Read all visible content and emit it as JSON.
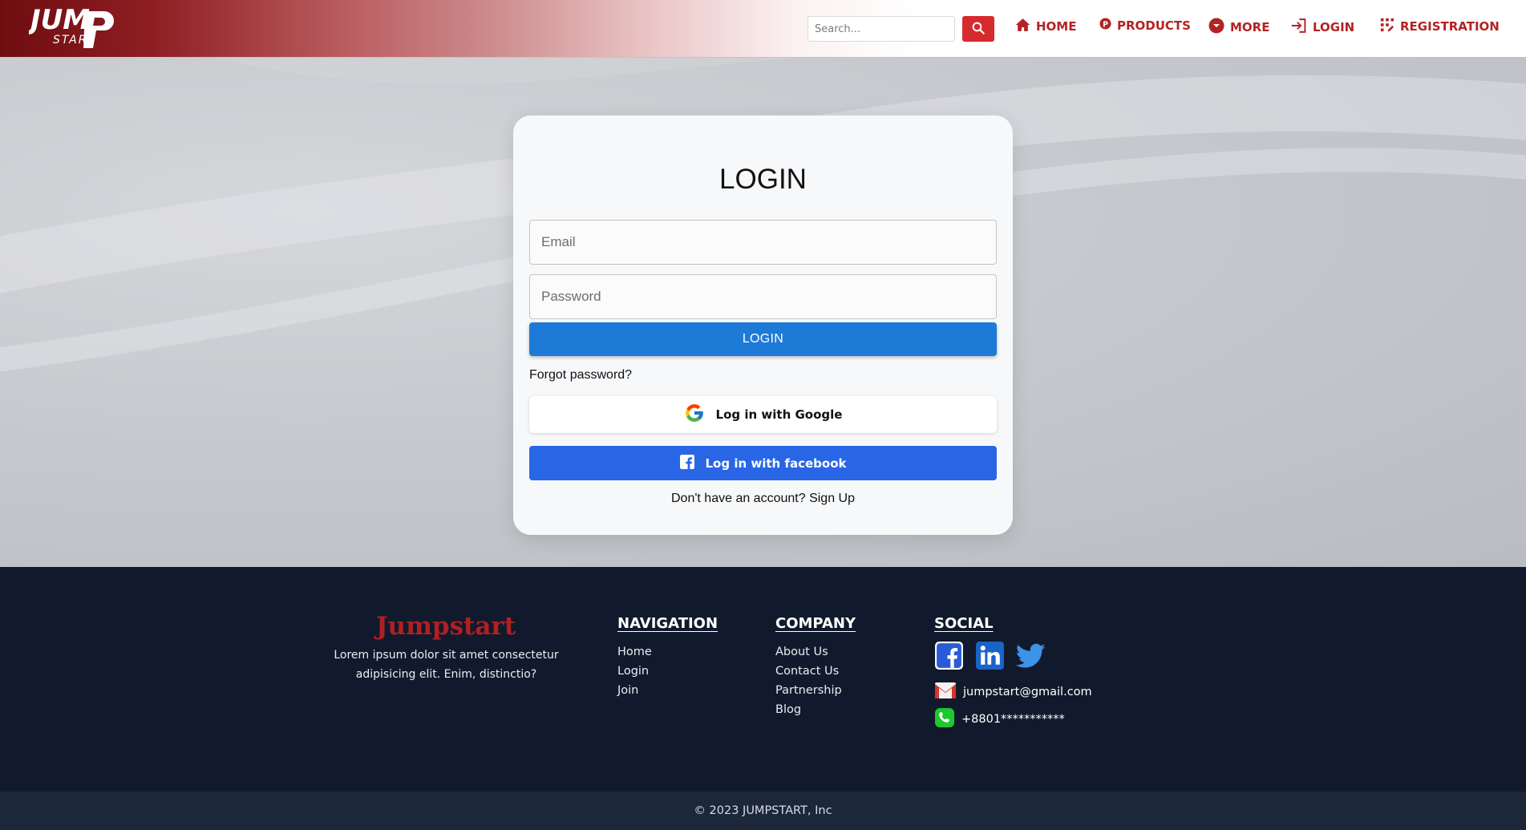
{
  "header": {
    "logo_text": "JUMP START",
    "search": {
      "placeholder": "Search..."
    },
    "nav": [
      {
        "label": "HOME",
        "icon": "home-icon"
      },
      {
        "label": "PRODUCTS",
        "icon": "p-badge-icon"
      },
      {
        "label": "MORE",
        "icon": "chevron-down-circle-icon"
      },
      {
        "label": "LOGIN",
        "icon": "login-icon"
      },
      {
        "label": "REGISTRATION",
        "icon": "registration-icon"
      }
    ]
  },
  "login_card": {
    "title": "LOGIN",
    "email_placeholder": "Email",
    "password_placeholder": "Password",
    "login_button": "LOGIN",
    "forgot_password": "Forgot password?",
    "google_button": "Log in with Google",
    "facebook_button": "Log in with facebook",
    "signup_prompt": "Don't have an account?",
    "signup_link": "Sign Up"
  },
  "footer": {
    "brand": "Jumpstart",
    "description": "Lorem ipsum dolor sit amet consectetur adipisicing elit. Enim, distinctio?",
    "navigation": {
      "title": "NAVIGATION",
      "items": [
        "Home",
        "Login",
        "Join"
      ]
    },
    "company": {
      "title": "COMPANY",
      "items": [
        "About Us",
        "Contact Us",
        "Partnership",
        "Blog"
      ]
    },
    "social": {
      "title": "SOCIAL",
      "icons": [
        "facebook-icon",
        "linkedin-icon",
        "twitter-icon"
      ],
      "email": "jumpstart@gmail.com",
      "phone": "+8801***********"
    },
    "copyright": "© 2023 JUMPSTART, Inc"
  },
  "colors": {
    "brand_red": "#b32325",
    "primary_blue": "#1e7ad7",
    "facebook_blue": "#2866e6",
    "footer_bg": "#111a2c"
  }
}
